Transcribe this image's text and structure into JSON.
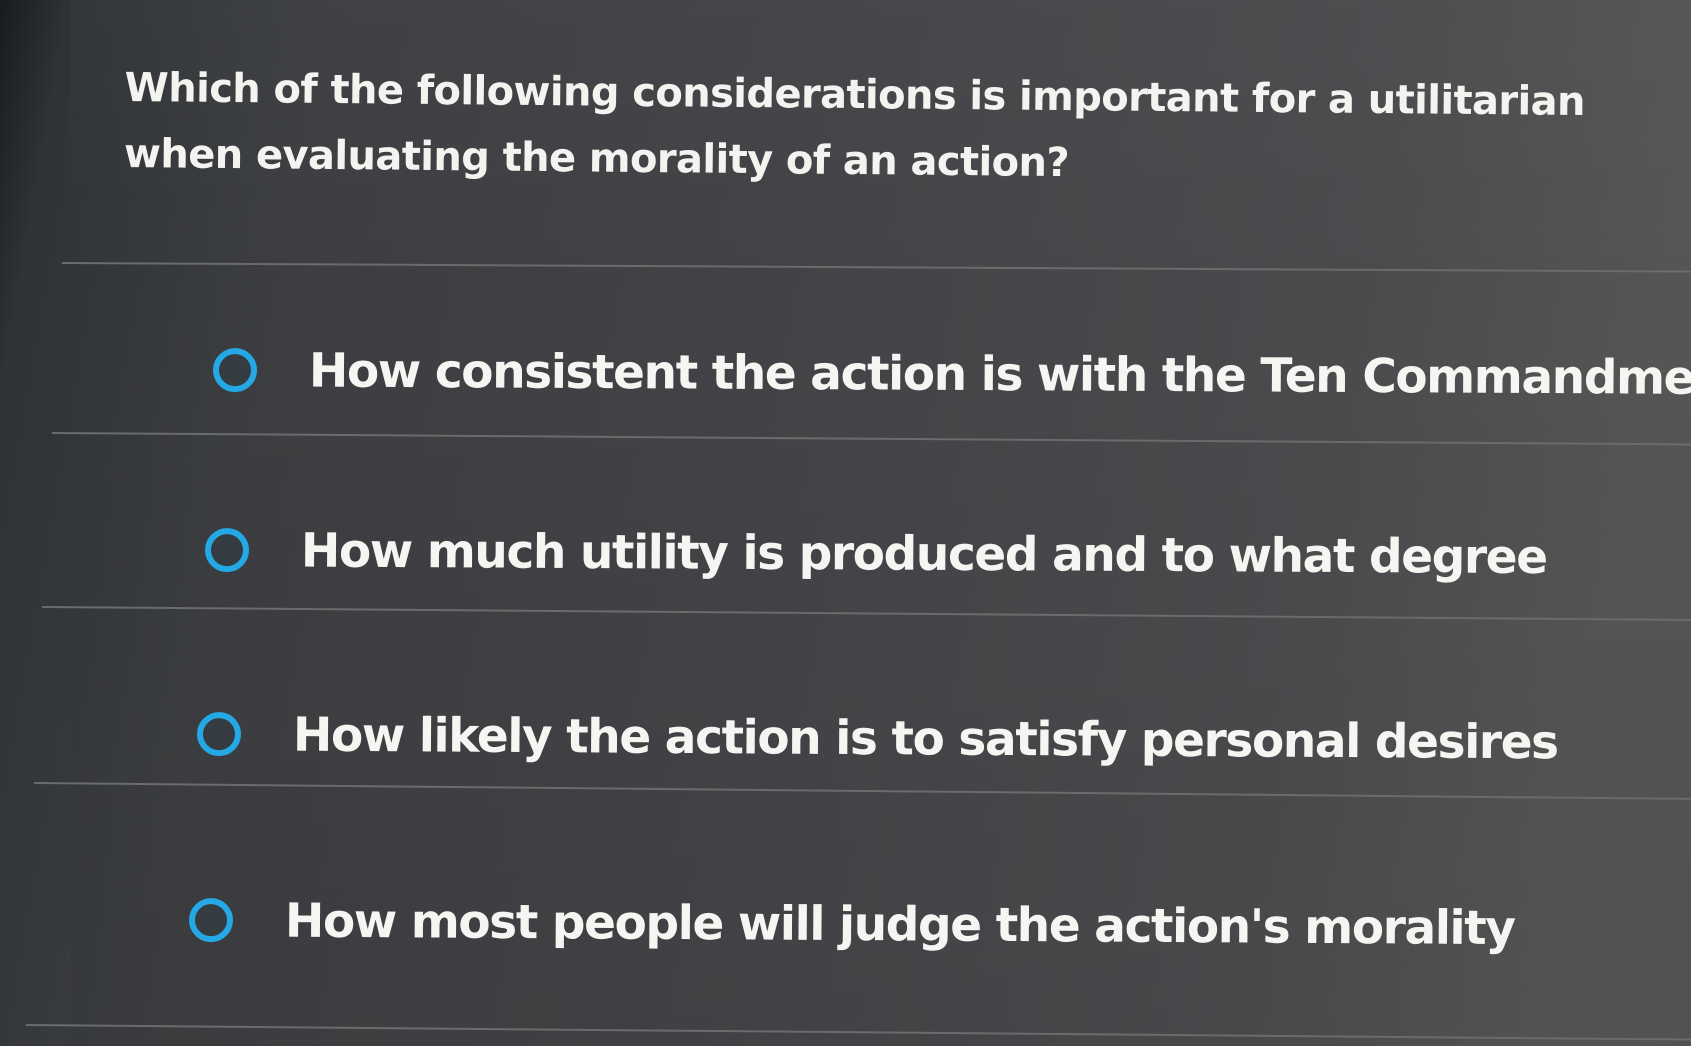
{
  "question": {
    "text": "Which of the following considerations is important for a utilitarian when evaluating the morality of an action?"
  },
  "options": [
    {
      "label": "How consistent the action is with the Ten Commandments",
      "selected": false
    },
    {
      "label": "How much utility is produced and to what degree",
      "selected": false
    },
    {
      "label": "How likely the action is to satisfy personal desires",
      "selected": false
    },
    {
      "label": "How most people will judge the action's morality",
      "selected": false
    }
  ],
  "colors": {
    "radio_accent": "#25a9e6",
    "text": "#f5f5f2",
    "background": "#424447"
  }
}
